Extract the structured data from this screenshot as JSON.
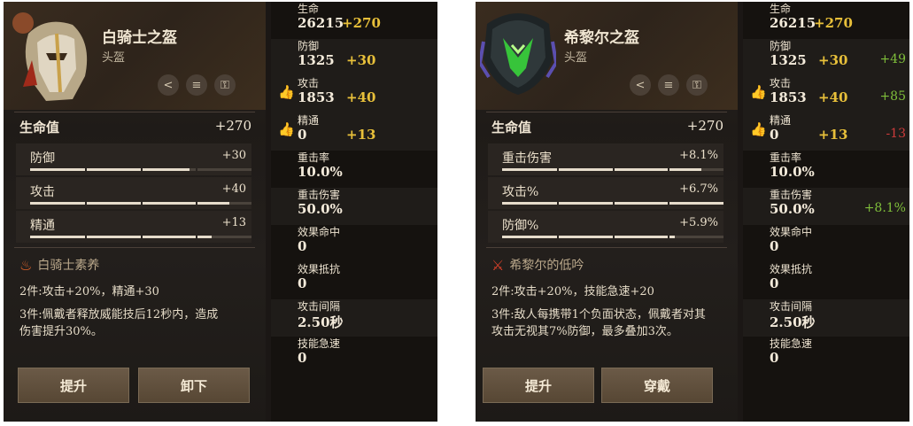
{
  "left": {
    "item_name": "白骑士之盔",
    "item_type": "头盔",
    "main_stat": {
      "label": "生命值",
      "value": "+270"
    },
    "substats": [
      {
        "label": "防御",
        "value": "+30",
        "fill": 0.72
      },
      {
        "label": "攻击",
        "value": "+40",
        "fill": 0.9
      },
      {
        "label": "精通",
        "value": "+13",
        "fill": 0.82
      }
    ],
    "set_name": "白骑士素养",
    "set_desc_2": "2件:攻击+20%，精通+30",
    "set_desc_3": "3件:佩戴者释放威能技后12秒内，造成伤害提升30%。",
    "buttons": {
      "upgrade": "提升",
      "action": "卸下"
    },
    "stats": [
      {
        "name": "生命",
        "base": "26215",
        "plus": "+270",
        "diff": "",
        "thumb": false
      },
      {
        "name": "防御",
        "base": "1325",
        "plus": "+30",
        "diff": "",
        "thumb": false
      },
      {
        "name": "攻击",
        "base": "1853",
        "plus": "+40",
        "diff": "",
        "thumb": true
      },
      {
        "name": "精通",
        "base": "0",
        "plus": "+13",
        "diff": "",
        "thumb": true
      },
      {
        "name": "重击率",
        "base": "10.0%",
        "plus": "",
        "diff": "",
        "thumb": false
      },
      {
        "name": "重击伤害",
        "base": "50.0%",
        "plus": "",
        "diff": "",
        "thumb": false
      },
      {
        "name": "效果命中",
        "base": "0",
        "plus": "",
        "diff": "",
        "thumb": false
      },
      {
        "name": "效果抵抗",
        "base": "0",
        "plus": "",
        "diff": "",
        "thumb": false
      },
      {
        "name": "攻击间隔",
        "base": "2.50秒",
        "plus": "",
        "diff": "",
        "thumb": false
      },
      {
        "name": "技能急速",
        "base": "0",
        "plus": "",
        "diff": "",
        "thumb": false
      }
    ]
  },
  "right": {
    "item_name": "希黎尔之盔",
    "item_type": "头盔",
    "main_stat": {
      "label": "生命值",
      "value": "+270"
    },
    "substats": [
      {
        "label": "重击伤害",
        "value": "+8.1%",
        "fill": 0.9
      },
      {
        "label": "攻击%",
        "value": "+6.7%",
        "fill": 1.0
      },
      {
        "label": "防御%",
        "value": "+5.9%",
        "fill": 0.78
      }
    ],
    "set_name": "希黎尔的低吟",
    "set_desc_2": "2件:攻击+20%，技能急速+20",
    "set_desc_3": "3件:敌人每携带1个负面状态，佩戴者对其攻击无视其7%防御，最多叠加3次。",
    "buttons": {
      "upgrade": "提升",
      "action": "穿戴"
    },
    "stats": [
      {
        "name": "生命",
        "base": "26215",
        "plus": "+270",
        "diff": "",
        "diff_type": "",
        "thumb": false
      },
      {
        "name": "防御",
        "base": "1325",
        "plus": "+30",
        "diff": "+49",
        "diff_type": "up",
        "thumb": false
      },
      {
        "name": "攻击",
        "base": "1853",
        "plus": "+40",
        "diff": "+85",
        "diff_type": "up",
        "thumb": true
      },
      {
        "name": "精通",
        "base": "0",
        "plus": "+13",
        "diff": "-13",
        "diff_type": "down",
        "thumb": true
      },
      {
        "name": "重击率",
        "base": "10.0%",
        "plus": "",
        "diff": "",
        "diff_type": "",
        "thumb": false
      },
      {
        "name": "重击伤害",
        "base": "50.0%",
        "plus": "",
        "diff": "+8.1%",
        "diff_type": "up",
        "thumb": false
      },
      {
        "name": "效果命中",
        "base": "0",
        "plus": "",
        "diff": "",
        "diff_type": "",
        "thumb": false
      },
      {
        "name": "效果抵抗",
        "base": "0",
        "plus": "",
        "diff": "",
        "diff_type": "",
        "thumb": false
      },
      {
        "name": "攻击间隔",
        "base": "2.50秒",
        "plus": "",
        "diff": "",
        "diff_type": "",
        "thumb": false
      },
      {
        "name": "技能急速",
        "base": "0",
        "plus": "",
        "diff": "",
        "diff_type": "",
        "thumb": false
      }
    ]
  },
  "icons": {
    "share": "share-icon",
    "lock": "lock-icon",
    "stack": "stack-icon",
    "thumb": "thumbs-up-icon"
  }
}
